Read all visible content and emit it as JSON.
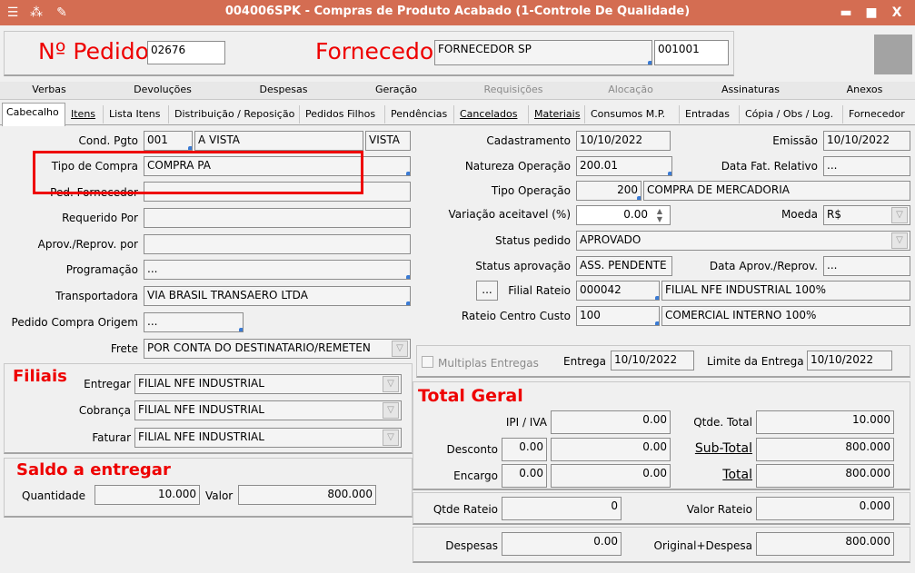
{
  "window": {
    "title": "004006SPK - Compras de Produto Acabado (1-Controle De Qualidade)",
    "minimize": "▬",
    "maximize": "■",
    "close": "X"
  },
  "header": {
    "pedido_label": "Nº Pedido",
    "pedido_value": "02676",
    "fornecedor_label": "Fornecedor",
    "fornecedor_name": "FORNECEDOR SP",
    "fornecedor_code": "001001"
  },
  "tabs_top": [
    "Verbas",
    "Devoluções",
    "Despesas",
    "Geração",
    "Requisições",
    "Alocação",
    "Assinaturas",
    "Anexos"
  ],
  "tabs_main": [
    "Cabecalho",
    "Itens",
    "Lista Itens",
    "Distribuição / Reposição",
    "Pedidos Filhos",
    "Pendências",
    "Cancelados",
    "Materiais",
    "Consumos M.P.",
    "Entradas",
    "Cópia / Obs / Log.",
    "Fornecedor"
  ],
  "left": {
    "cond_pgto_label": "Cond. Pgto",
    "cond_pgto_code": "001",
    "cond_pgto_desc": "A VISTA",
    "cond_pgto_type": "VISTA",
    "tipo_compra_label": "Tipo de Compra",
    "tipo_compra_value": "COMPRA PA",
    "ped_fornecedor_label": "Ped. Fornecedor",
    "requerido_label": "Requerido Por",
    "aprov_label": "Aprov./Reprov. por",
    "programacao_label": "Programação",
    "programacao_value": "...",
    "transportadora_label": "Transportadora",
    "transportadora_value": "VIA BRASIL TRANSAERO LTDA",
    "pedido_origem_label": "Pedido Compra Origem",
    "pedido_origem_value": "...",
    "frete_label": "Frete",
    "frete_value": "POR CONTA DO DESTINATARIO/REMETEN"
  },
  "right": {
    "cadastramento_label": "Cadastramento",
    "cadastramento_value": "10/10/2022",
    "emissao_label": "Emissão",
    "emissao_value": "10/10/2022",
    "natureza_label": "Natureza Operação",
    "natureza_value": "200.01",
    "data_fat_label": "Data Fat. Relativo",
    "data_fat_value": "...",
    "tipo_operacao_label": "Tipo Operação",
    "tipo_operacao_code": "200",
    "tipo_operacao_desc": "COMPRA DE MERCADORIA",
    "variacao_label": "Variação aceitavel (%)",
    "variacao_value": "0.00",
    "moeda_label": "Moeda",
    "moeda_value": "R$",
    "status_pedido_label": "Status pedido",
    "status_pedido_value": "APROVADO",
    "status_aprov_label": "Status aprovação",
    "status_aprov_value": "ASS. PENDENTE",
    "data_aprov_label": "Data Aprov./Reprov.",
    "data_aprov_value": "...",
    "filial_rateio_btn": "...",
    "filial_rateio_label": "Filial Rateio",
    "filial_rateio_code": "000042",
    "filial_rateio_desc": "FILIAL NFE INDUSTRIAL 100%",
    "rateio_cc_label": "Rateio Centro Custo",
    "rateio_cc_code": "100",
    "rateio_cc_desc": "COMERCIAL INTERNO 100%"
  },
  "filiais": {
    "title": "Filiais",
    "entregar_label": "Entregar",
    "entregar_value": "FILIAL NFE INDUSTRIAL",
    "cobranca_label": "Cobrança",
    "cobranca_value": "FILIAL NFE INDUSTRIAL",
    "faturar_label": "Faturar",
    "faturar_value": "FILIAL NFE INDUSTRIAL"
  },
  "saldo": {
    "title": "Saldo a entregar",
    "quantidade_label": "Quantidade",
    "quantidade_value": "10.000",
    "valor_label": "Valor",
    "valor_value": "800.000"
  },
  "entrega": {
    "multiplas_label": "Multiplas Entregas",
    "entrega_label": "Entrega",
    "entrega_value": "10/10/2022",
    "limite_label": "Limite da Entrega",
    "limite_value": "10/10/2022"
  },
  "total": {
    "title": "Total Geral",
    "ipi_label": "IPI / IVA",
    "ipi_value": "0.00",
    "qtde_total_label": "Qtde. Total",
    "qtde_total_value": "10.000",
    "desconto_label": "Desconto",
    "desconto_pct": "0.00",
    "desconto_value": "0.00",
    "subtotal_label": "Sub-Total",
    "subtotal_value": "800.000",
    "encargo_label": "Encargo",
    "encargo_pct": "0.00",
    "encargo_value": "0.00",
    "total_label": "Total",
    "total_value": "800.000",
    "qtde_rateio_label": "Qtde Rateio",
    "qtde_rateio_value": "0",
    "valor_rateio_label": "Valor Rateio",
    "valor_rateio_value": "0.000",
    "despesas_label": "Despesas",
    "despesas_value": "0.00",
    "original_label": "Original+Despesa",
    "original_value": "800.000"
  },
  "colors": {
    "titlebar": "#d46d52",
    "accent_red": "#e00000",
    "highlight_box": "#e00000"
  }
}
